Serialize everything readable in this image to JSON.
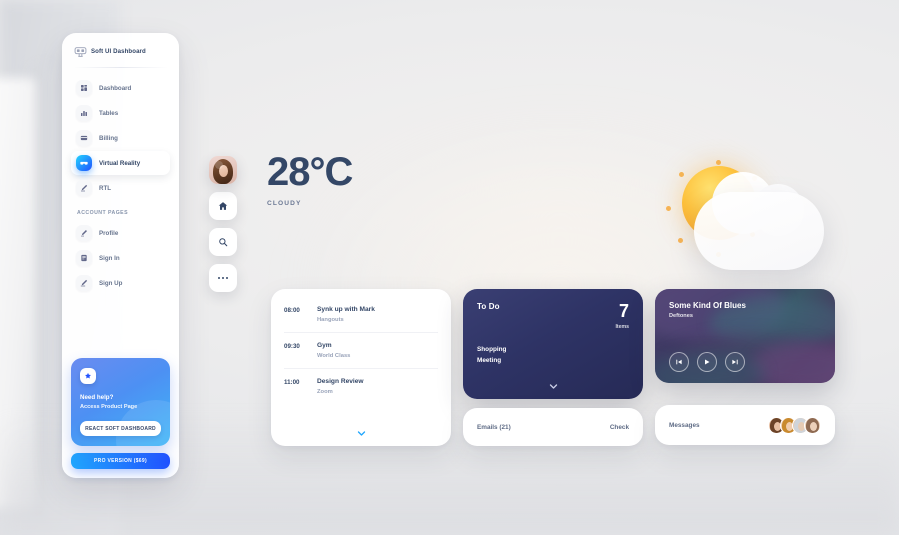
{
  "sidebar": {
    "brand": "Soft UI Dashboard",
    "brand_icon": "vr-headset-logo-icon",
    "nav": [
      {
        "label": "Dashboard",
        "icon": "dashboard-icon",
        "active": false
      },
      {
        "label": "Tables",
        "icon": "tables-icon",
        "active": false
      },
      {
        "label": "Billing",
        "icon": "billing-card-icon",
        "active": false
      },
      {
        "label": "Virtual Reality",
        "icon": "vr-icon",
        "active": true
      },
      {
        "label": "RTL",
        "icon": "rtl-icon",
        "active": false
      }
    ],
    "section_label": "ACCOUNT PAGES",
    "account_nav": [
      {
        "label": "Profile",
        "icon": "profile-icon",
        "active": false
      },
      {
        "label": "Sign In",
        "icon": "sign-in-icon",
        "active": false
      },
      {
        "label": "Sign Up",
        "icon": "sign-up-icon",
        "active": false
      }
    ],
    "promo": {
      "badge_icon": "cup-star-icon",
      "title": "Need help?",
      "subtitle": "Access Product Page",
      "button": "REACT SOFT DASHBOARD"
    },
    "pro_button": "PRO VERSION ($69)"
  },
  "rail": {
    "avatar_name": "user-avatar",
    "buttons": [
      {
        "name": "home-icon"
      },
      {
        "name": "search-icon"
      },
      {
        "name": "more-options-icon"
      }
    ]
  },
  "weather": {
    "temperature": "28°C",
    "condition": "CLOUDY",
    "art_icon": "sun-behind-cloud-icon"
  },
  "schedule": {
    "expand_icon": "chevron-down-icon",
    "events": [
      {
        "time": "08:00",
        "title": "Synk up with Mark",
        "source": "Hangouts"
      },
      {
        "time": "09:30",
        "title": "Gym",
        "source": "World Class"
      },
      {
        "time": "11:00",
        "title": "Design Review",
        "source": "Zoom"
      }
    ]
  },
  "todo": {
    "title": "To Do",
    "count": "7",
    "count_label": "Items",
    "items": [
      "Shopping",
      "Meeting"
    ],
    "expand_icon": "chevron-down-icon"
  },
  "emails": {
    "label": "Emails (21)",
    "action": "Check"
  },
  "music": {
    "title": "Some Kind Of Blues",
    "artist": "Deftones",
    "controls": [
      {
        "name": "previous-track-icon"
      },
      {
        "name": "play-icon"
      },
      {
        "name": "next-track-icon"
      }
    ]
  },
  "messages": {
    "label": "Messages",
    "avatars": [
      {
        "name": "message-avatar",
        "hair": "#6b4328",
        "face": "#e7c0a4"
      },
      {
        "name": "message-avatar",
        "hair": "#c98a2e",
        "face": "#f0cdae"
      },
      {
        "name": "message-avatar",
        "hair": "#cfd4da",
        "face": "#e6cbb4"
      },
      {
        "name": "message-avatar",
        "hair": "#8e6a52",
        "face": "#ecd0ba"
      }
    ]
  },
  "colors": {
    "accent": "#21d4fd",
    "accent2": "#2152ff",
    "text_dark": "#344767",
    "text_muted": "#67748e",
    "todo_bg": "#2e3365"
  }
}
